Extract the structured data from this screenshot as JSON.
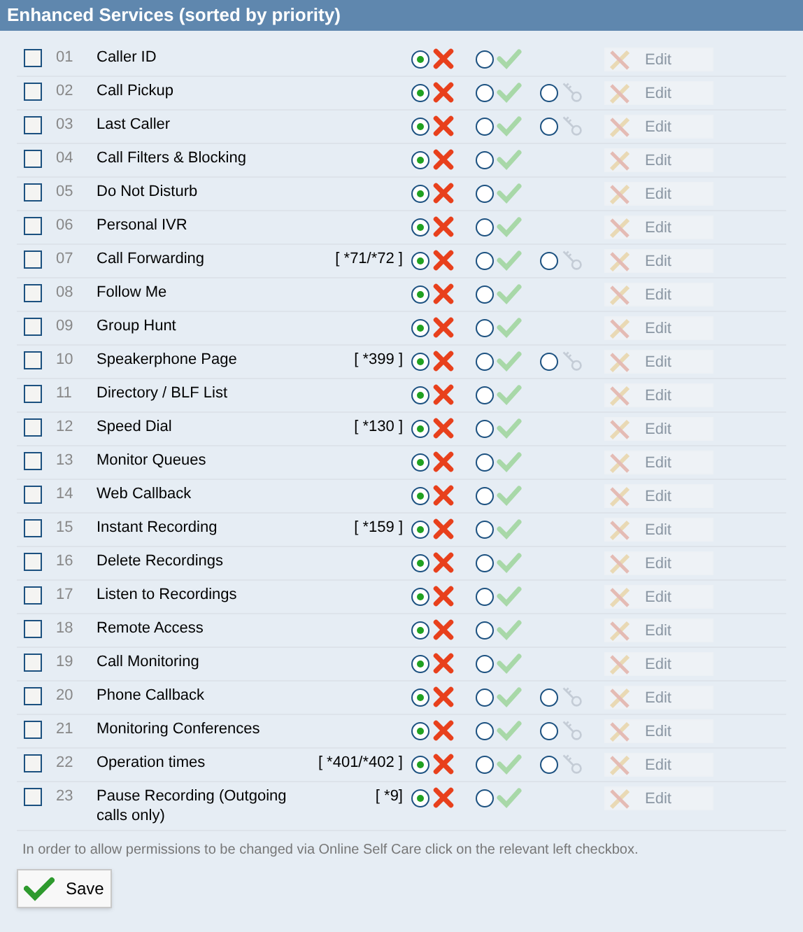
{
  "title": "Enhanced Services (sorted by priority)",
  "rows": [
    {
      "number": "01",
      "name": "Caller ID",
      "checked": false,
      "options": [
        {
          "kind": "deny",
          "selected": true
        },
        {
          "kind": "allow",
          "selected": false
        }
      ],
      "edit": {
        "label": "Edit",
        "disabled": true
      }
    },
    {
      "number": "02",
      "name": "Call Pickup",
      "checked": false,
      "options": [
        {
          "kind": "deny",
          "selected": true
        },
        {
          "kind": "allow",
          "selected": false
        },
        {
          "kind": "key",
          "selected": false
        }
      ],
      "edit": {
        "label": "Edit",
        "disabled": true
      }
    },
    {
      "number": "03",
      "name": "Last Caller",
      "checked": false,
      "options": [
        {
          "kind": "deny",
          "selected": true
        },
        {
          "kind": "allow",
          "selected": false
        },
        {
          "kind": "key",
          "selected": false
        }
      ],
      "edit": {
        "label": "Edit",
        "disabled": true
      }
    },
    {
      "number": "04",
      "name": "Call Filters & Blocking",
      "checked": false,
      "options": [
        {
          "kind": "deny",
          "selected": true
        },
        {
          "kind": "allow",
          "selected": false
        }
      ],
      "edit": {
        "label": "Edit",
        "disabled": true
      }
    },
    {
      "number": "05",
      "name": "Do Not Disturb",
      "checked": false,
      "options": [
        {
          "kind": "deny",
          "selected": true
        },
        {
          "kind": "allow",
          "selected": false
        }
      ],
      "edit": {
        "label": "Edit",
        "disabled": true
      }
    },
    {
      "number": "06",
      "name": "Personal IVR",
      "checked": false,
      "options": [
        {
          "kind": "deny",
          "selected": true
        },
        {
          "kind": "allow",
          "selected": false
        }
      ],
      "edit": {
        "label": "Edit",
        "disabled": true
      }
    },
    {
      "number": "07",
      "name": "Call Forwarding",
      "code": "[ *71/*72 ]",
      "checked": false,
      "options": [
        {
          "kind": "deny",
          "selected": true
        },
        {
          "kind": "allow",
          "selected": false
        },
        {
          "kind": "key",
          "selected": false
        }
      ],
      "edit": {
        "label": "Edit",
        "disabled": true
      }
    },
    {
      "number": "08",
      "name": "Follow Me",
      "checked": false,
      "options": [
        {
          "kind": "deny",
          "selected": true
        },
        {
          "kind": "allow",
          "selected": false
        }
      ],
      "edit": {
        "label": "Edit",
        "disabled": true
      }
    },
    {
      "number": "09",
      "name": "Group Hunt",
      "checked": false,
      "options": [
        {
          "kind": "deny",
          "selected": true
        },
        {
          "kind": "allow",
          "selected": false
        }
      ],
      "edit": {
        "label": "Edit",
        "disabled": true
      }
    },
    {
      "number": "10",
      "name": "Speakerphone Page",
      "code": "[ *399 ]",
      "checked": false,
      "options": [
        {
          "kind": "deny",
          "selected": true
        },
        {
          "kind": "allow",
          "selected": false
        },
        {
          "kind": "key",
          "selected": false
        }
      ],
      "edit": {
        "label": "Edit",
        "disabled": true
      }
    },
    {
      "number": "11",
      "name": "Directory / BLF List",
      "checked": false,
      "options": [
        {
          "kind": "deny",
          "selected": true
        },
        {
          "kind": "allow",
          "selected": false
        }
      ],
      "edit": {
        "label": "Edit",
        "disabled": true
      }
    },
    {
      "number": "12",
      "name": "Speed Dial",
      "code": "[ *130 ]",
      "checked": false,
      "options": [
        {
          "kind": "deny",
          "selected": true
        },
        {
          "kind": "allow",
          "selected": false
        }
      ],
      "edit": {
        "label": "Edit",
        "disabled": true
      }
    },
    {
      "number": "13",
      "name": "Monitor Queues",
      "checked": false,
      "options": [
        {
          "kind": "deny",
          "selected": true
        },
        {
          "kind": "allow",
          "selected": false
        }
      ],
      "edit": {
        "label": "Edit",
        "disabled": true
      }
    },
    {
      "number": "14",
      "name": "Web Callback",
      "checked": false,
      "options": [
        {
          "kind": "deny",
          "selected": true
        },
        {
          "kind": "allow",
          "selected": false
        }
      ],
      "edit": {
        "label": "Edit",
        "disabled": true
      }
    },
    {
      "number": "15",
      "name": "Instant Recording",
      "code": "[ *159 ]",
      "checked": false,
      "options": [
        {
          "kind": "deny",
          "selected": true
        },
        {
          "kind": "allow",
          "selected": false
        }
      ],
      "edit": {
        "label": "Edit",
        "disabled": true
      }
    },
    {
      "number": "16",
      "name": "Delete Recordings",
      "checked": false,
      "options": [
        {
          "kind": "deny",
          "selected": true
        },
        {
          "kind": "allow",
          "selected": false
        }
      ],
      "edit": {
        "label": "Edit",
        "disabled": true
      }
    },
    {
      "number": "17",
      "name": "Listen to Recordings",
      "checked": false,
      "options": [
        {
          "kind": "deny",
          "selected": true
        },
        {
          "kind": "allow",
          "selected": false
        }
      ],
      "edit": {
        "label": "Edit",
        "disabled": true
      }
    },
    {
      "number": "18",
      "name": "Remote Access",
      "checked": false,
      "options": [
        {
          "kind": "deny",
          "selected": true
        },
        {
          "kind": "allow",
          "selected": false
        }
      ],
      "edit": {
        "label": "Edit",
        "disabled": true
      }
    },
    {
      "number": "19",
      "name": "Call Monitoring",
      "checked": false,
      "options": [
        {
          "kind": "deny",
          "selected": true
        },
        {
          "kind": "allow",
          "selected": false
        }
      ],
      "edit": {
        "label": "Edit",
        "disabled": true
      }
    },
    {
      "number": "20",
      "name": "Phone Callback",
      "checked": false,
      "options": [
        {
          "kind": "deny",
          "selected": true
        },
        {
          "kind": "allow",
          "selected": false
        },
        {
          "kind": "key",
          "selected": false
        }
      ],
      "edit": {
        "label": "Edit",
        "disabled": true
      }
    },
    {
      "number": "21",
      "name": "Monitoring Conferences",
      "checked": false,
      "options": [
        {
          "kind": "deny",
          "selected": true
        },
        {
          "kind": "allow",
          "selected": false
        },
        {
          "kind": "key",
          "selected": false
        }
      ],
      "edit": {
        "label": "Edit",
        "disabled": true
      }
    },
    {
      "number": "22",
      "name": "Operation times",
      "code": "[ *401/*402 ]",
      "checked": false,
      "options": [
        {
          "kind": "deny",
          "selected": true
        },
        {
          "kind": "allow",
          "selected": false
        },
        {
          "kind": "key",
          "selected": false
        }
      ],
      "edit": {
        "label": "Edit",
        "disabled": true
      }
    },
    {
      "number": "23",
      "name": "Pause Recording (Outgoing calls only)",
      "code": "[ *9]",
      "checked": false,
      "options": [
        {
          "kind": "deny",
          "selected": true
        },
        {
          "kind": "allow",
          "selected": false
        }
      ],
      "edit": {
        "label": "Edit",
        "disabled": true
      }
    }
  ],
  "note": "In order to allow permissions to be changed via Online Self Care click on the relevant left checkbox.",
  "save": {
    "label": "Save"
  }
}
